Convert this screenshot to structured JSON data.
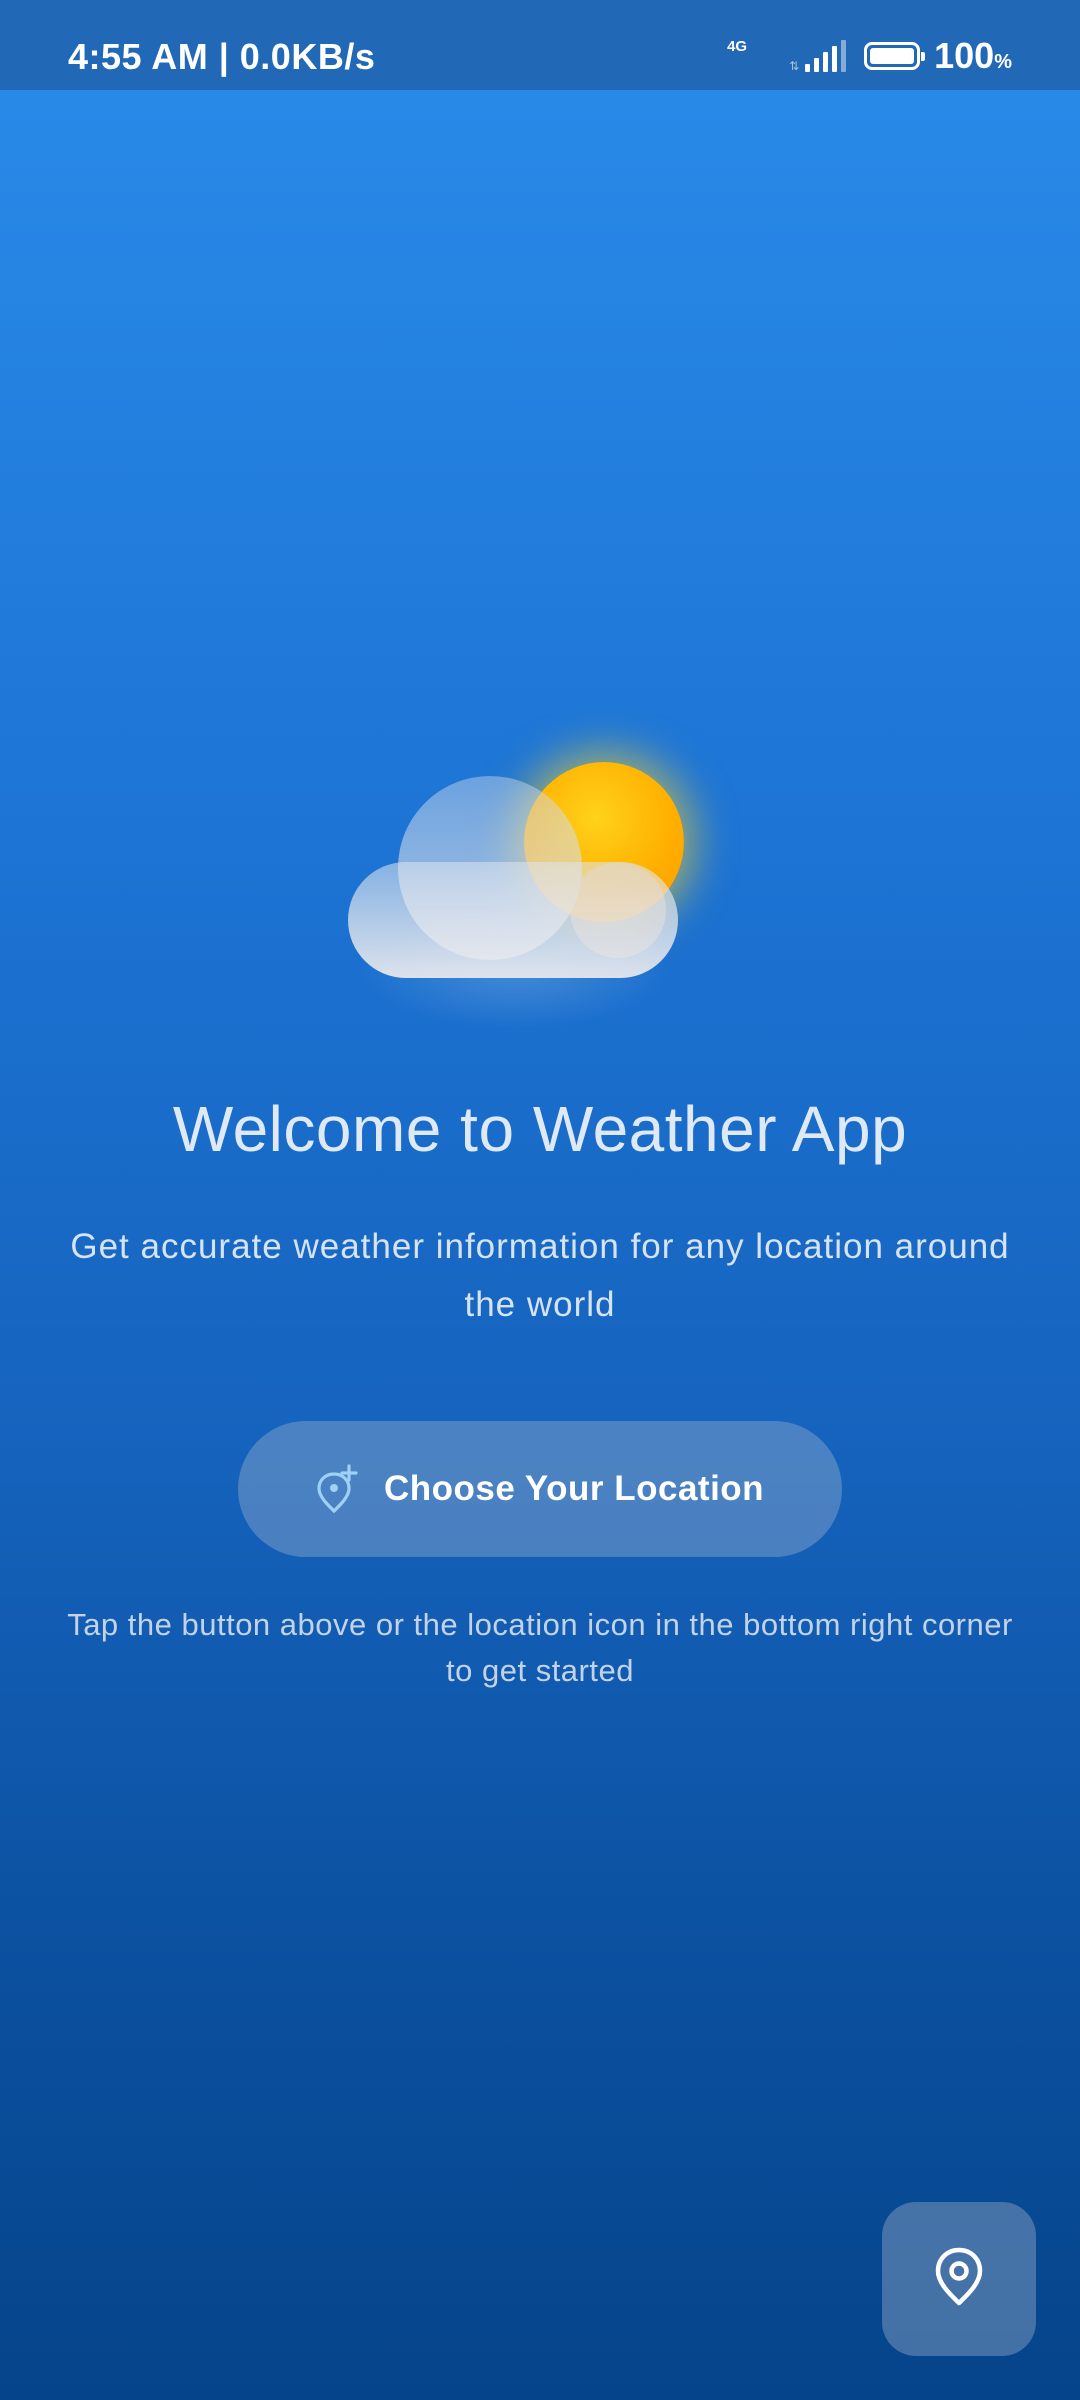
{
  "status_bar": {
    "time_speed": "4:55 AM | 0.0KB/s",
    "network_type": "4G",
    "battery_level": "100",
    "battery_unit": "%"
  },
  "hero": {
    "icon": "partly-cloudy-icon",
    "sun_color": "#ffb000"
  },
  "welcome": {
    "title": "Welcome to Weather App",
    "subtitle": "Get accurate weather information for any location around the world"
  },
  "choose_location_button": {
    "label": "Choose Your Location",
    "icon": "add-location-icon"
  },
  "hint": "Tap the button above or the location icon in the bottom right corner to get started",
  "fab": {
    "icon": "location-pin-icon"
  },
  "colors": {
    "gradient_top": "#2a8cea",
    "gradient_bottom": "#05448a",
    "status_bar": "#2168b6"
  }
}
